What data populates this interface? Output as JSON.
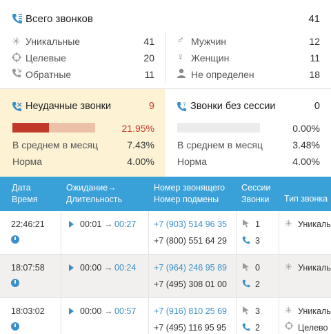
{
  "summary": {
    "total_label": "Всего звонков",
    "total_value": "41",
    "left": [
      {
        "label": "Уникальные",
        "value": "41"
      },
      {
        "label": "Целевые",
        "value": "20"
      },
      {
        "label": "Обратные",
        "value": "11"
      }
    ],
    "right": [
      {
        "label": "Мужчин",
        "value": "12"
      },
      {
        "label": "Женщин",
        "value": "11"
      },
      {
        "label": "Не определен",
        "value": "18"
      }
    ]
  },
  "failed": {
    "title": "Неудачные звонки",
    "count": "9",
    "percent_text": "21.95%",
    "percent": 0.2195,
    "avg_label": "В среднем в месяц",
    "avg_value": "7.43%",
    "norm_label": "Норма",
    "norm_value": "4.00%"
  },
  "nosession": {
    "title": "Звонки без сессии",
    "count": "0",
    "percent_text": "0.00%",
    "percent": 0,
    "avg_label": "В среднем в месяц",
    "avg_value": "3.48%",
    "norm_label": "Норма",
    "norm_value": "4.00%"
  },
  "table": {
    "headers": {
      "col1_line1": "Дата",
      "col1_line2": "Время",
      "col2_line1": "Ожидание→",
      "col2_line2": "Длительность",
      "col3_line1": "Номер звонящего",
      "col3_line2": "Номер подмены",
      "col4_line1": "Сессии",
      "col4_line2": "Звонки",
      "col5_line1": "Тип звонка"
    },
    "rows": [
      {
        "time": "22:46:21",
        "wait": "00:01",
        "arrow": "→",
        "duration": "00:27",
        "caller": "+7 (903) 514 96 35",
        "replacement": "+7 (800) 551 64 29",
        "sessions": "1",
        "calls": "3",
        "types": [
          "Уникаль"
        ]
      },
      {
        "time": "18:07:58",
        "wait": "00:00",
        "arrow": "→",
        "duration": "00:24",
        "caller": "+7 (964) 246 95 89",
        "replacement": "+7 (495) 308 01 00",
        "sessions": "0",
        "calls": "2",
        "types": [
          "Уникаль"
        ]
      },
      {
        "time": "18:03:02",
        "wait": "00:00",
        "arrow": "→",
        "duration": "00:57",
        "caller": "+7 (916) 810 25 69",
        "replacement": "+7 (495) 116 95 95",
        "sessions": "3",
        "calls": "2",
        "types": [
          "Уникаль",
          "Целево"
        ]
      }
    ]
  },
  "colors": {
    "accent": "#3aa0d8",
    "failed_bg": "#fdf2d4",
    "bar_fill": "#c0392b",
    "bar_track": "#edc0a8",
    "neutral_track": "#ececec",
    "row_alt": "#f2f0ee"
  }
}
